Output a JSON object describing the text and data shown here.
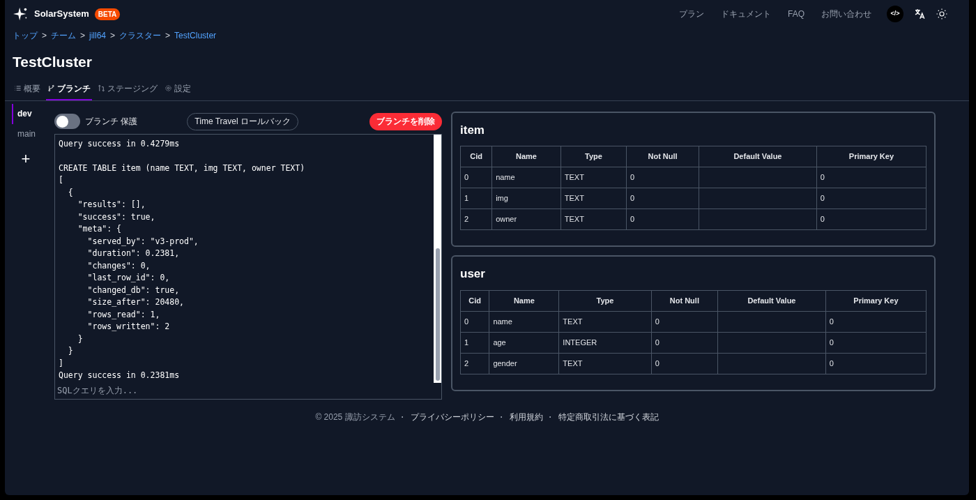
{
  "header": {
    "brand": "SolarSystem",
    "badge": "BETA",
    "nav": [
      "プラン",
      "ドキュメント",
      "FAQ",
      "お問い合わせ"
    ],
    "dev_badge": "</>"
  },
  "breadcrumb": [
    {
      "kind": "link",
      "text": "トップ"
    },
    {
      "kind": "separator",
      "text": ">"
    },
    {
      "kind": "link",
      "text": "チーム"
    },
    {
      "kind": "separator",
      "text": ">"
    },
    {
      "kind": "link",
      "text": "jill64"
    },
    {
      "kind": "separator",
      "text": ">"
    },
    {
      "kind": "link",
      "text": "クラスター"
    },
    {
      "kind": "separator",
      "text": ">"
    },
    {
      "kind": "link",
      "text": "TestCluster"
    }
  ],
  "title": "TestCluster",
  "tabs": [
    {
      "label": "概要",
      "selected": false
    },
    {
      "label": "ブランチ",
      "selected": true
    },
    {
      "label": "ステージング",
      "selected": false
    },
    {
      "label": "設定",
      "selected": false
    }
  ],
  "branches": [
    {
      "label": "dev",
      "selected": true
    },
    {
      "label": "main",
      "selected": false
    }
  ],
  "add_branch": "+",
  "protect_toggle": {
    "label": "ブランチ 保護",
    "on": false
  },
  "rollback_button": "Time Travel ロールバック",
  "delete_button": "ブランチを削除",
  "console": {
    "blocks": [
      [
        "Query success in 0.4279ms"
      ],
      [
        "CREATE TABLE item (name TEXT, img TEXT, owner TEXT)",
        "[",
        "  {",
        "    \"results\": [],",
        "    \"success\": true,",
        "    \"meta\": {",
        "      \"served_by\": \"v3-prod\",",
        "      \"duration\": 0.2381,",
        "      \"changes\": 0,",
        "      \"last_row_id\": 0,",
        "      \"changed_db\": true,",
        "      \"size_after\": 20480,",
        "      \"rows_read\": 1,",
        "      \"rows_written\": 2",
        "    }",
        "  }",
        "]",
        "Query success in 0.2381ms"
      ]
    ],
    "placeholder": "SQLクエリを入力..."
  },
  "tables": [
    {
      "name": "item",
      "columns": [
        "Cid",
        "Name",
        "Type",
        "Not Null",
        "Default Value",
        "Primary Key"
      ],
      "rows": [
        [
          "0",
          "name",
          "TEXT",
          "0",
          "",
          "0"
        ],
        [
          "1",
          "img",
          "TEXT",
          "0",
          "",
          "0"
        ],
        [
          "2",
          "owner",
          "TEXT",
          "0",
          "",
          "0"
        ]
      ]
    },
    {
      "name": "user",
      "columns": [
        "Cid",
        "Name",
        "Type",
        "Not Null",
        "Default Value",
        "Primary Key"
      ],
      "rows": [
        [
          "0",
          "name",
          "TEXT",
          "0",
          "",
          "0"
        ],
        [
          "1",
          "age",
          "INTEGER",
          "0",
          "",
          "0"
        ],
        [
          "2",
          "gender",
          "TEXT",
          "0",
          "",
          "0"
        ]
      ]
    }
  ],
  "footer": [
    {
      "kind": "text",
      "text": "© 2025 諏訪システム"
    },
    {
      "kind": "separator",
      "text": "·"
    },
    {
      "kind": "link",
      "text": "プライバシーポリシー"
    },
    {
      "kind": "separator",
      "text": "·"
    },
    {
      "kind": "link",
      "text": "利用規約"
    },
    {
      "kind": "separator",
      "text": "·"
    },
    {
      "kind": "link",
      "text": "特定商取引法に基づく表記"
    }
  ]
}
